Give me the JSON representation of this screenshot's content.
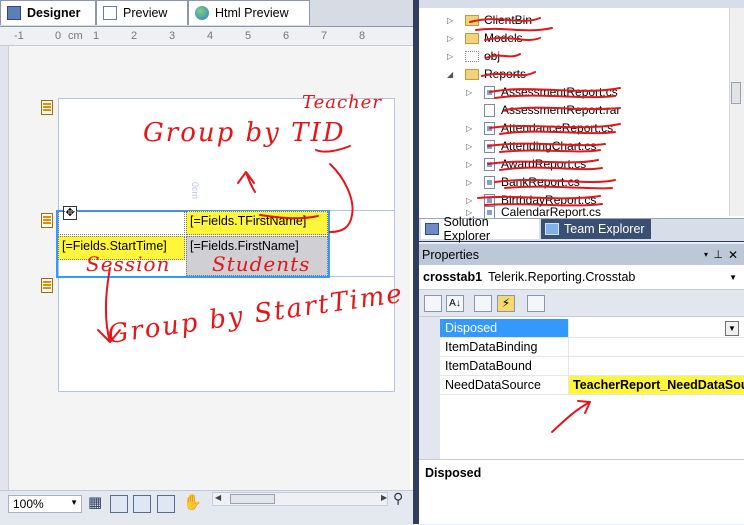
{
  "designer": {
    "tabs": [
      {
        "label": "Designer",
        "icon": "designer-icon"
      },
      {
        "label": "Preview",
        "icon": "preview-icon"
      },
      {
        "label": "Html Preview",
        "icon": "globe-icon"
      }
    ],
    "ruler": [
      "-1",
      "0",
      "cm",
      "1",
      "2",
      "3",
      "4",
      "5",
      "6",
      "7",
      "8"
    ],
    "cells": {
      "teacher_header": "[=Fields.TFirstName]",
      "session_header": "[=Fields.StartTime]",
      "detail": "[=Fields.FirstName]"
    },
    "zoom": "100%",
    "vertical_fade": "0cm"
  },
  "solution_explorer": {
    "items": [
      {
        "label": "ClientBin",
        "type": "folder"
      },
      {
        "label": "Models",
        "type": "folder"
      },
      {
        "label": "obj",
        "type": "folder"
      },
      {
        "label": "Reports",
        "type": "folder-open"
      },
      {
        "label": "AssessmentReport.cs",
        "type": "report"
      },
      {
        "label": "AssessmentReport.rar",
        "type": "file"
      },
      {
        "label": "AttendanceReport.cs",
        "type": "report"
      },
      {
        "label": "AttendingChart.cs",
        "type": "report"
      },
      {
        "label": "AwardReport.cs",
        "type": "report"
      },
      {
        "label": "BankReport.cs",
        "type": "report"
      },
      {
        "label": "BirthdayReport.cs",
        "type": "report"
      },
      {
        "label": "CalendarReport.cs",
        "type": "report"
      }
    ],
    "tabs": [
      "Solution Explorer",
      "Team Explorer"
    ]
  },
  "properties": {
    "title": "Properties",
    "object_name": "crosstab1",
    "object_type": "Telerik.Reporting.Crosstab",
    "rows": [
      {
        "name": "Disposed",
        "value": ""
      },
      {
        "name": "ItemDataBinding",
        "value": ""
      },
      {
        "name": "ItemDataBound",
        "value": ""
      },
      {
        "name": "NeedDataSource",
        "value": "TeacherReport_NeedDataSour"
      }
    ],
    "description": "Disposed"
  },
  "annotations": {
    "teacher": "Teacher",
    "group_tid": "Group by TID",
    "session": "Session",
    "students": "Students",
    "group_start": "Group by StartTime"
  },
  "colors": {
    "highlight": "#fff53b",
    "ink": "#e3161a",
    "selection": "#3399ff"
  }
}
